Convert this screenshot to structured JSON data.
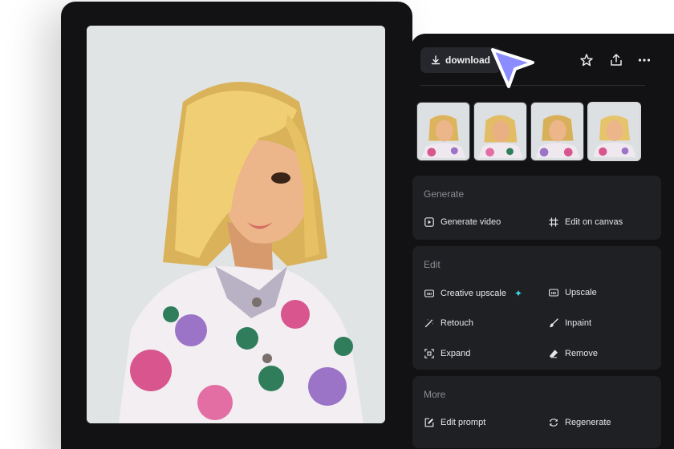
{
  "toolbar": {
    "download_label": "download",
    "icons": [
      "download-icon",
      "star-icon",
      "share-icon",
      "more-icon"
    ]
  },
  "thumbnails": [
    {
      "label": "variation-1",
      "selected": false
    },
    {
      "label": "variation-2",
      "selected": false
    },
    {
      "label": "variation-3",
      "selected": false
    },
    {
      "label": "variation-4",
      "selected": true
    }
  ],
  "sections": {
    "generate": {
      "title": "Generate",
      "generate_video": "Generate video",
      "edit_on_canvas": "Edit on canvas"
    },
    "edit": {
      "title": "Edit",
      "creative_upscale": "Creative upscale",
      "upscale": "Upscale",
      "retouch": "Retouch",
      "inpaint": "Inpaint",
      "expand": "Expand",
      "remove": "Remove"
    },
    "more": {
      "title": "More",
      "edit_prompt": "Edit prompt",
      "regenerate": "Regenerate"
    }
  },
  "colors": {
    "panel_bg": "#121214",
    "card_bg": "#1f2024",
    "accent_cursor": "#8b8cff",
    "sparkle": "#41d6e6"
  }
}
